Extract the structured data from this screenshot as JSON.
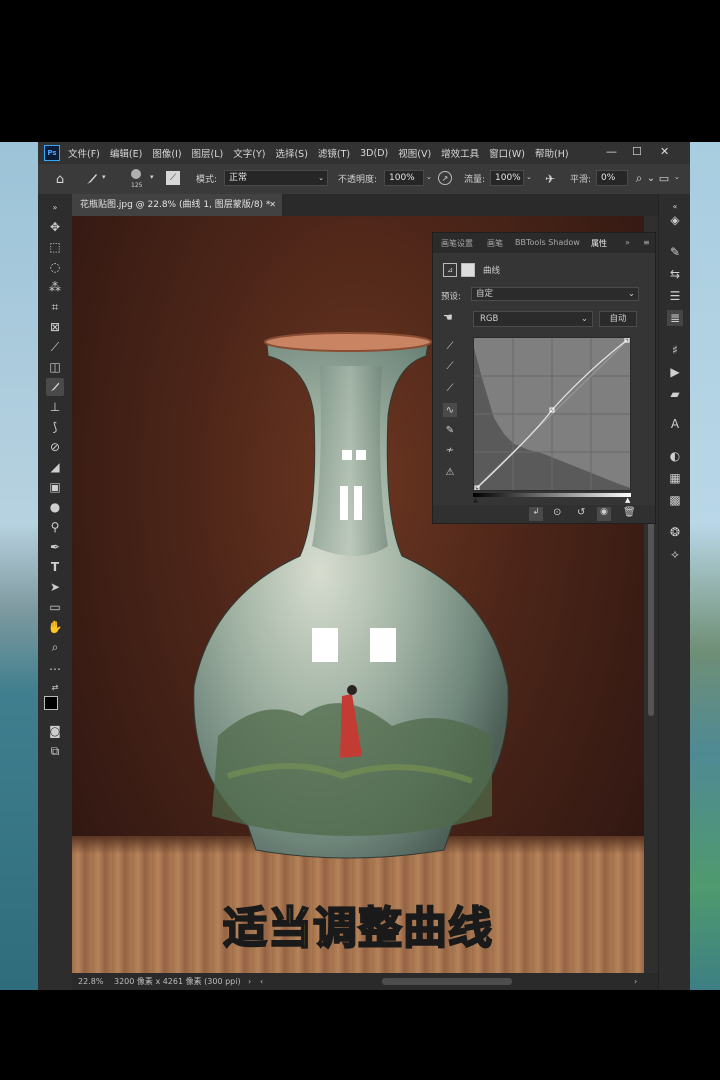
{
  "menu": {
    "logo": "Ps",
    "items": [
      "文件(F)",
      "编辑(E)",
      "图像(I)",
      "图层(L)",
      "文字(Y)",
      "选择(S)",
      "滤镜(T)",
      "3D(D)",
      "视图(V)",
      "增效工具",
      "窗口(W)",
      "帮助(H)"
    ]
  },
  "options": {
    "brush_size": "125",
    "mode_label": "模式:",
    "mode_value": "正常",
    "opacity_label": "不透明度:",
    "opacity_value": "100%",
    "flow_label": "流量:",
    "flow_value": "100%",
    "smooth_label": "平滑:",
    "smooth_value": "0%"
  },
  "document": {
    "tab_title": "花瓶贴图.jpg @ 22.8% (曲线 1, 图层蒙版/8) *",
    "subtitle": "适当调整曲线"
  },
  "properties": {
    "tabs": [
      "画笔设置",
      "画笔",
      "BBTools Shadow",
      "属性"
    ],
    "active_tab": "属性",
    "adjustment_name": "曲线",
    "preset_label": "预设:",
    "preset_value": "自定",
    "channel_value": "RGB",
    "auto_button": "自动"
  },
  "status": {
    "zoom": "22.8%",
    "doc_info": "3200 像素 x 4261 像素 (300 ppi)"
  },
  "colors": {
    "ps_blue": "#31a8ff",
    "subtitle_yellow": "#ffe02a"
  }
}
